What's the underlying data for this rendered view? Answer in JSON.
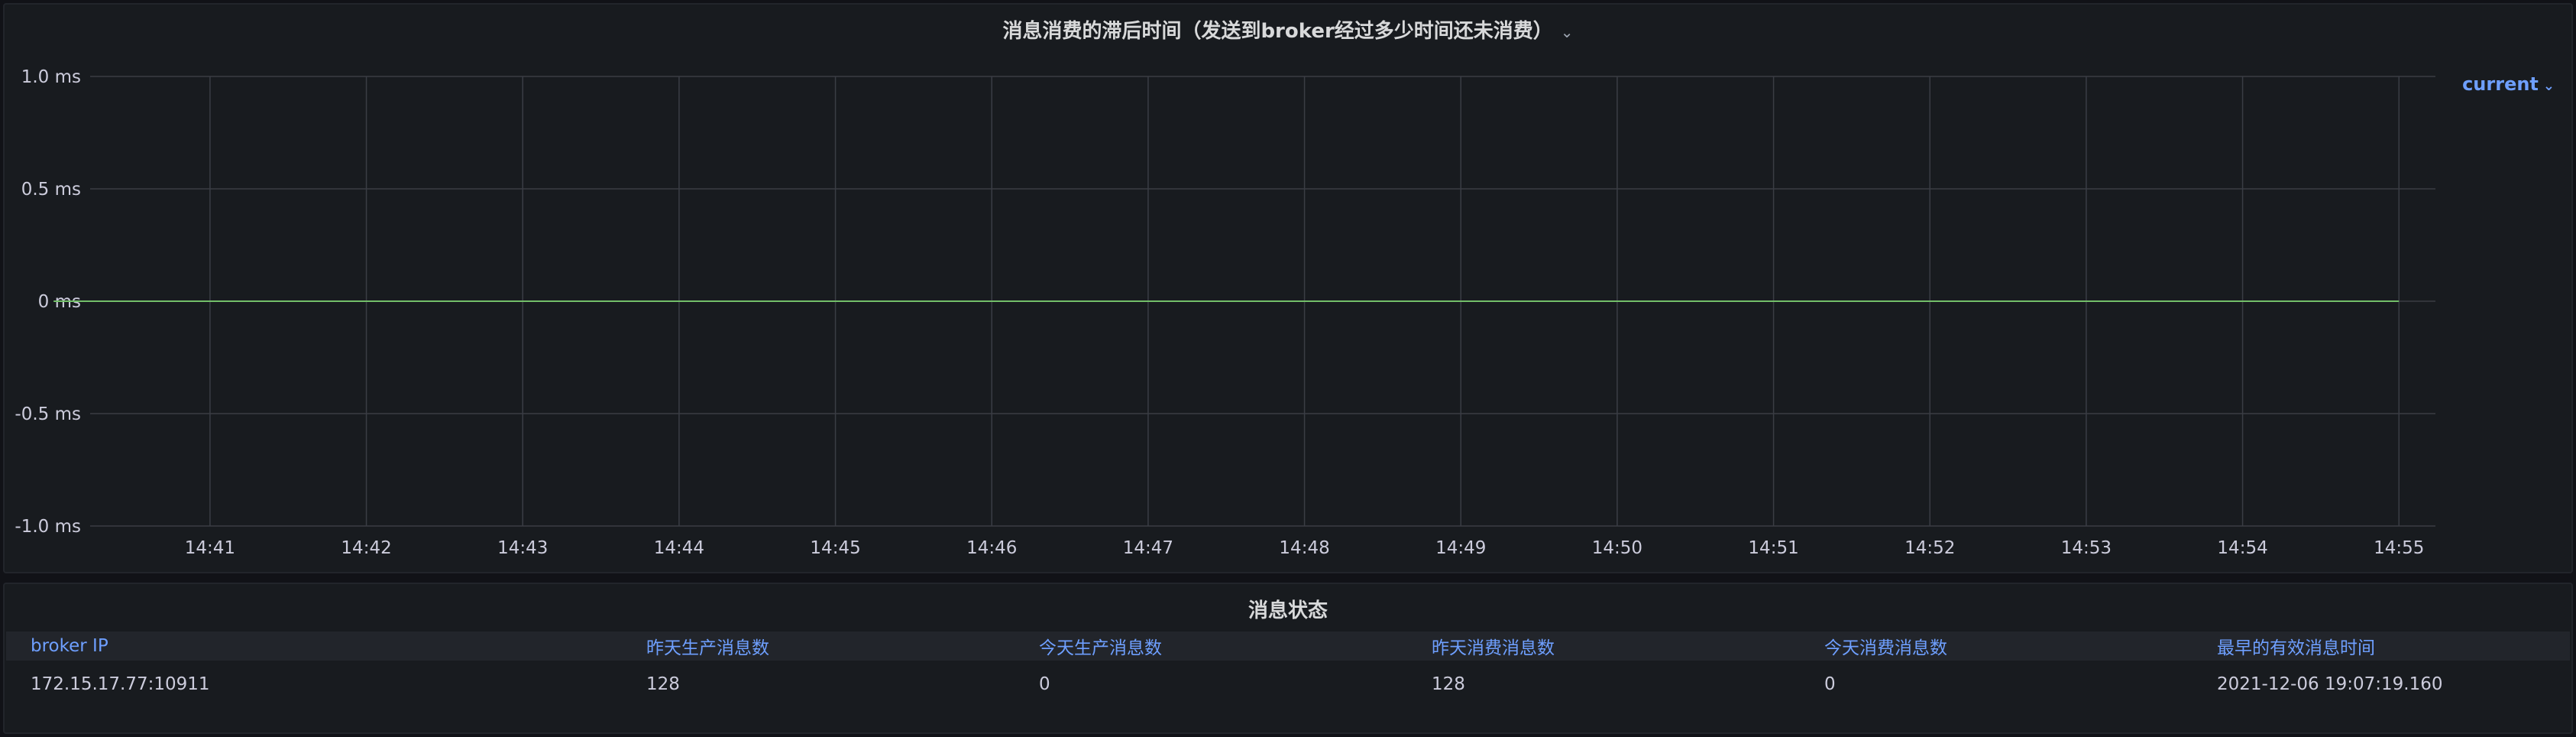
{
  "graph_panel": {
    "title": "消息消费的滞后时间（发送到broker经过多少时间还未消费）",
    "legend_label": "current",
    "icons": {
      "title_menu": "chevron-down-icon",
      "legend_menu": "chevron-down-icon"
    }
  },
  "chart_data": {
    "type": "line",
    "title": "消息消费的滞后时间（发送到broker经过多少时间还未消费）",
    "x": [
      "14:41",
      "14:42",
      "14:43",
      "14:44",
      "14:45",
      "14:46",
      "14:47",
      "14:48",
      "14:49",
      "14:50",
      "14:51",
      "14:52",
      "14:53",
      "14:54",
      "14:55"
    ],
    "x_start": "14:40:14",
    "x_end": "14:55:14",
    "series": [
      {
        "name": "current",
        "color": "#73bf69",
        "values": [
          0,
          0,
          0,
          0,
          0,
          0,
          0,
          0,
          0,
          0,
          0,
          0,
          0,
          0,
          0
        ],
        "start": "14:40",
        "end": "14:55"
      }
    ],
    "yticks": [
      "1.0 ms",
      "0.5 ms",
      "0 ms",
      "-0.5 ms",
      "-1.0 ms"
    ],
    "ytick_values": [
      1.0,
      0.5,
      0,
      -0.5,
      -1.0
    ],
    "ylim": [
      -1.0,
      1.0
    ],
    "yunit": "ms",
    "grid": true,
    "legend_position": "right"
  },
  "table_panel": {
    "title": "消息状态",
    "columns": [
      "broker IP",
      "昨天生产消息数",
      "今天生产消息数",
      "昨天消费消息数",
      "今天消费消息数",
      "最早的有效消息时间"
    ],
    "rows": [
      [
        "172.15.17.77:10911",
        "128",
        "0",
        "128",
        "0",
        "2021-12-06 19:07:19.160"
      ]
    ]
  },
  "colors": {
    "background": "#111217",
    "panel": "#181b1f",
    "grid": "#3a3d44",
    "series": "#73bf69",
    "header_text": "#6e9fff"
  }
}
